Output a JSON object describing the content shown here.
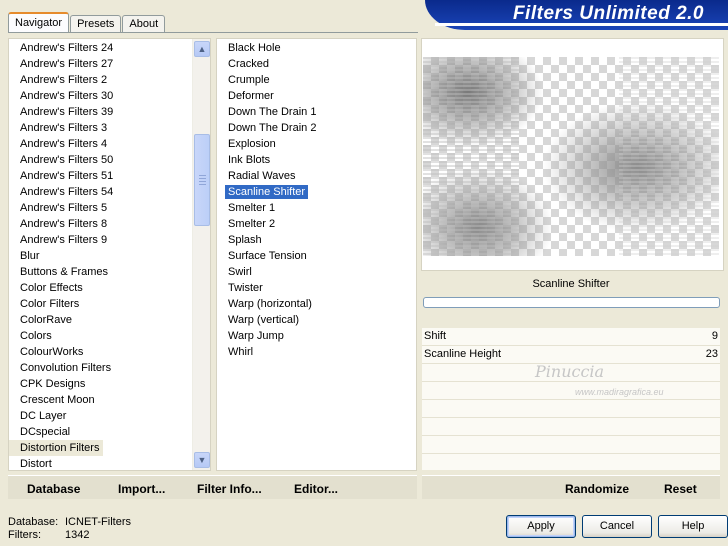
{
  "tabs": [
    {
      "label": "Navigator",
      "active": true
    },
    {
      "label": "Presets",
      "active": false
    },
    {
      "label": "About",
      "active": false
    }
  ],
  "banner": {
    "title": "Filters Unlimited 2.0"
  },
  "categories": {
    "items": [
      "Andrew's Filters 24",
      "Andrew's Filters 27",
      "Andrew's Filters 2",
      "Andrew's Filters 30",
      "Andrew's Filters 39",
      "Andrew's Filters 3",
      "Andrew's Filters 4",
      "Andrew's Filters 50",
      "Andrew's Filters 51",
      "Andrew's Filters 54",
      "Andrew's Filters 5",
      "Andrew's Filters 8",
      "Andrew's Filters 9",
      "Blur",
      "Buttons & Frames",
      "Color Effects",
      "Color Filters",
      "ColorRave",
      "Colors",
      "ColourWorks",
      "Convolution Filters",
      "CPK Designs",
      "Crescent Moon",
      "DC Layer",
      "DCspecial",
      "Distortion Filters",
      "Distort"
    ],
    "selected": "Distortion Filters"
  },
  "filters": {
    "items": [
      "Black Hole",
      "Cracked",
      "Crumple",
      "Deformer",
      "Down The Drain 1",
      "Down The Drain 2",
      "Explosion",
      "Ink Blots",
      "Radial Waves",
      "Scanline Shifter",
      "Smelter 1",
      "Smelter 2",
      "Splash",
      "Surface Tension",
      "Swirl",
      "Twister",
      "Warp (horizontal)",
      "Warp (vertical)",
      "Warp Jump",
      "Whirl"
    ],
    "selected": "Scanline Shifter"
  },
  "preview": {
    "filter_name": "Scanline Shifter"
  },
  "params": [
    {
      "name": "Shift",
      "value": "9"
    },
    {
      "name": "Scanline Height",
      "value": "23"
    }
  ],
  "left_buttons": {
    "database": "Database",
    "import": "Import...",
    "filter_info": "Filter Info...",
    "editor": "Editor..."
  },
  "right_buttons": {
    "randomize": "Randomize",
    "reset": "Reset"
  },
  "status": {
    "database_label": "Database:",
    "database_value": "ICNET-Filters",
    "filters_label": "Filters:",
    "filters_value": "1342"
  },
  "dialog_buttons": {
    "apply": "Apply",
    "cancel": "Cancel",
    "help": "Help"
  },
  "watermark": {
    "text": "Pinuccia",
    "url": "www.madiragrafica.eu"
  }
}
